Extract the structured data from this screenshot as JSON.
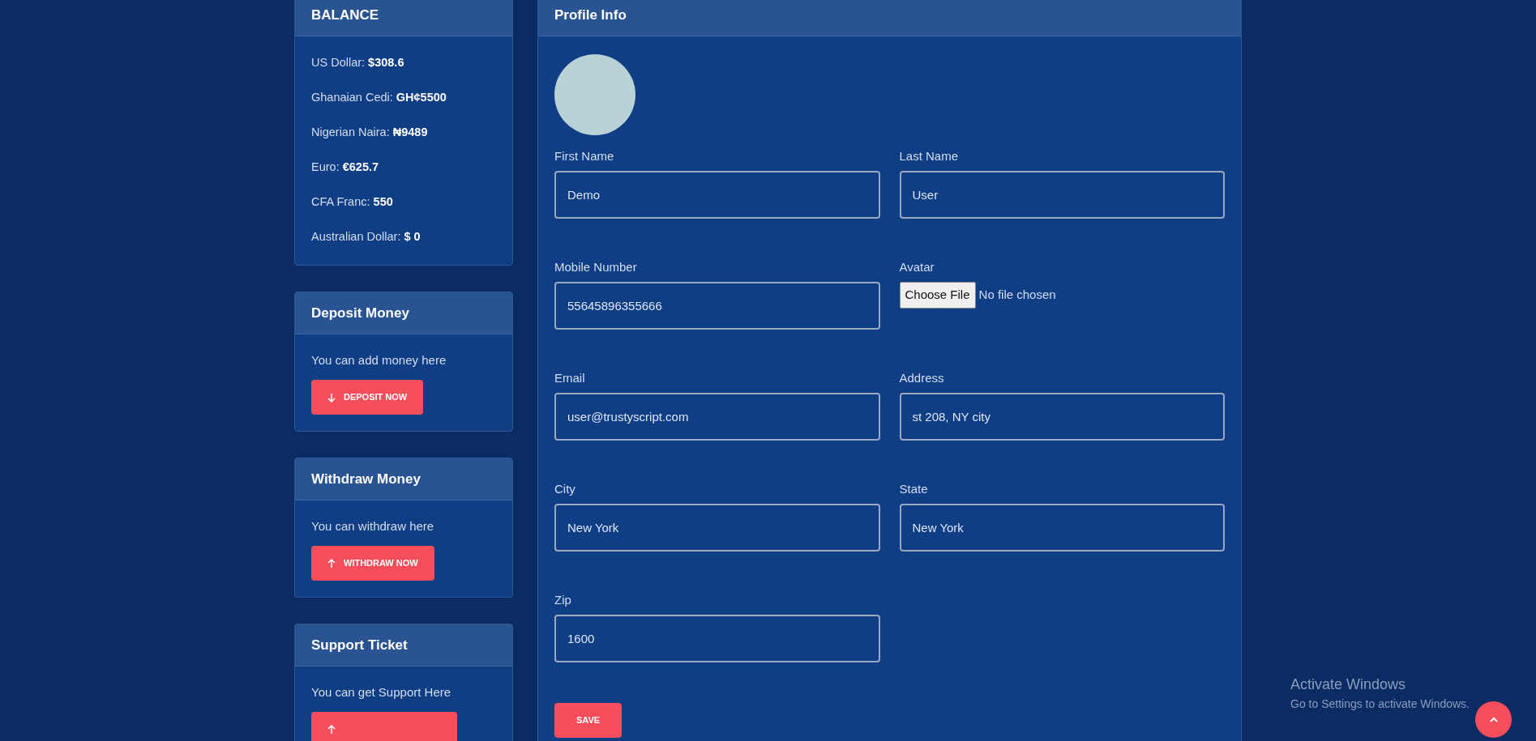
{
  "balance": {
    "title": "BALANCE",
    "items": [
      {
        "text": "US Dollar: **$308.6**"
      },
      {
        "text": "Ghanaian Cedi: **GH¢5500**"
      },
      {
        "text": "Nigerian Naira: **₦9489**"
      },
      {
        "text": "Euro: **€625.7**"
      },
      {
        "text": "CFA Franc: **550**"
      },
      {
        "text": "Australian Dollar: **$ 0**"
      }
    ]
  },
  "action_cards": [
    {
      "title": "Deposit Money",
      "text": "You can add money here",
      "button_label": "DEPOSIT NOW"
    },
    {
      "title": "Withdraw Money",
      "text": "You can withdraw here",
      "button_label": "WITHDRAW NOW"
    },
    {
      "title": "Support Ticket",
      "text": "You can get Support Here"
    }
  ],
  "profile": {
    "title": "Profile Info",
    "fields": [
      {
        "kind": "text",
        "label": "First Name",
        "value": "Demo"
      },
      {
        "kind": "text",
        "label": "Last Name",
        "value": "User"
      },
      {
        "kind": "text",
        "label": "Mobile Number",
        "value": "55645896355666"
      },
      {
        "kind": "file",
        "label": "Avatar",
        "button": "Choose File",
        "status": "No file chosen"
      },
      {
        "kind": "text",
        "label": "Email",
        "value": "user@trustyscript.com"
      },
      {
        "kind": "text",
        "label": "Address",
        "value": "st 208, NY city"
      },
      {
        "kind": "text",
        "label": "City",
        "value": "New York"
      },
      {
        "kind": "text",
        "label": "State",
        "value": "New York"
      },
      {
        "kind": "text",
        "label": "Zip",
        "value": "1600"
      }
    ],
    "save_button": "SAVE"
  },
  "os_notice": {
    "title": "Activate Windows",
    "text": "Go to Settings to activate Windows."
  }
}
